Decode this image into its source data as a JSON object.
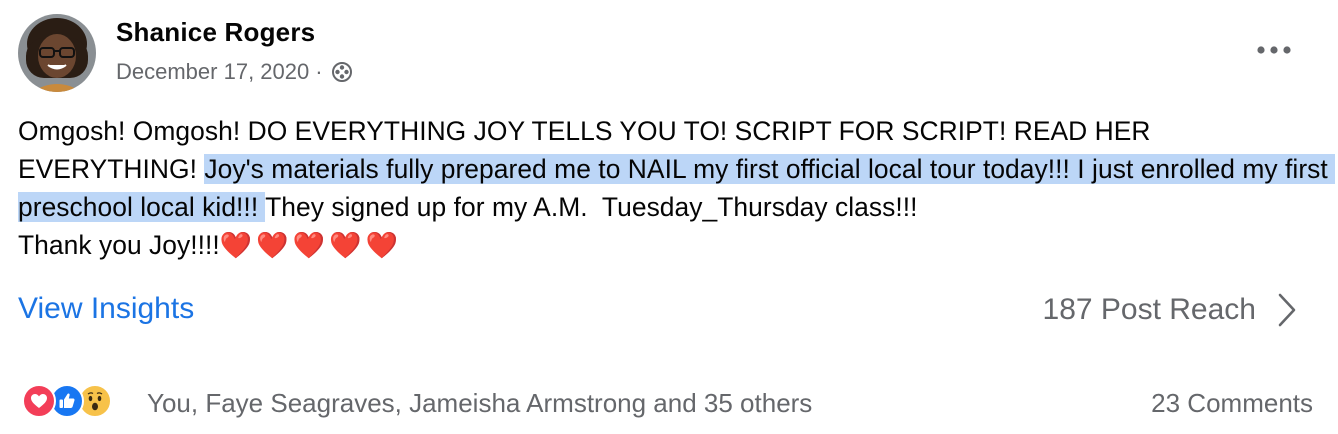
{
  "post": {
    "author": "Shanice Rogers",
    "date": "December 17, 2020",
    "separator": "·",
    "audience_icon": "friends-icon",
    "more_icon": "more-options-icon",
    "text_before_highlight": "Omgosh! Omgosh! DO EVERYTHING JOY TELLS YOU TO! SCRIPT FOR SCRIPT! READ HER\nEVERYTHING! ",
    "text_highlighted": "Joy's materials fully prepared me to NAIL my first official local tour today!!! I just enrolled my first preschool local kid!!! ",
    "text_after_highlight": "They signed up for my A.M.  Tuesday_Thursday class!!!\nThank you Joy!!!!",
    "hearts": [
      "❤️",
      "❤️",
      "❤️",
      "❤️",
      "❤️"
    ]
  },
  "insights": {
    "view_insights_label": "View Insights",
    "post_reach_label": "187 Post Reach"
  },
  "footer": {
    "reactions": [
      "love",
      "like",
      "wow"
    ],
    "reactors_text": "You, Faye Seagraves, Jameisha Armstrong and 35 others",
    "comments_label": "23 Comments"
  },
  "colors": {
    "link_blue": "#1b74e4",
    "highlight": "#bcd6f7",
    "secondary_text": "#65676b",
    "love_red": "#f33e58",
    "like_blue": "#1877f2",
    "wow_yellow": "#f7c24a"
  }
}
